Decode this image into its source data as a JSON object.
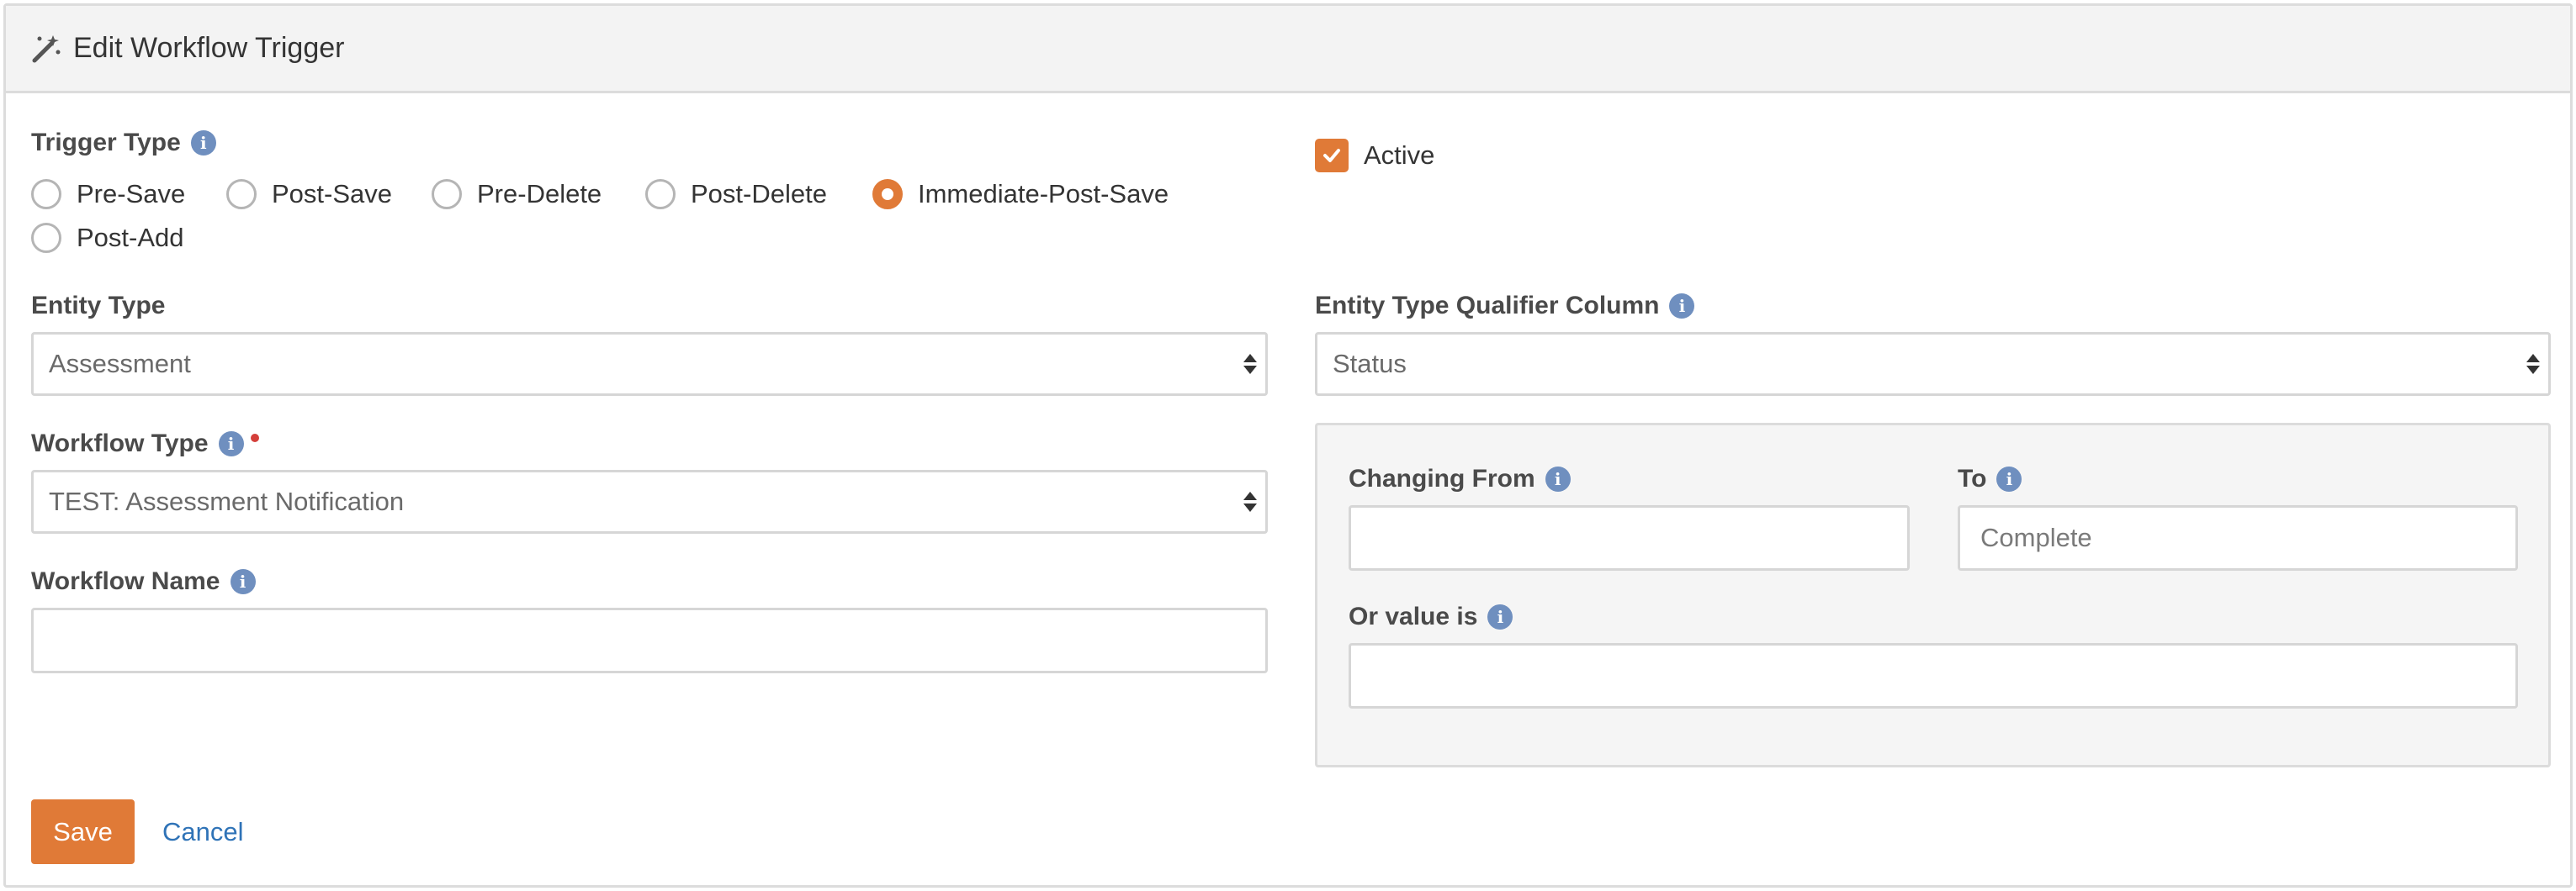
{
  "header": {
    "title": "Edit Workflow Trigger",
    "icon": "magic-wand-icon"
  },
  "trigger_type": {
    "label": "Trigger Type",
    "options": [
      "Pre-Save",
      "Post-Save",
      "Pre-Delete",
      "Post-Delete",
      "Immediate-Post-Save",
      "Post-Add"
    ],
    "selected": "Immediate-Post-Save"
  },
  "active": {
    "label": "Active",
    "checked": true
  },
  "entity_type": {
    "label": "Entity Type",
    "value": "Assessment"
  },
  "entity_qualifier": {
    "label": "Entity Type Qualifier Column",
    "value": "Status"
  },
  "workflow_type": {
    "label": "Workflow Type",
    "value": "TEST: Assessment Notification",
    "required": true
  },
  "workflow_name": {
    "label": "Workflow Name",
    "value": ""
  },
  "qualifier_values": {
    "changing_from_label": "Changing From",
    "changing_from_value": "",
    "to_label": "To",
    "to_placeholder": "Complete",
    "or_value_label": "Or value is",
    "or_value_value": ""
  },
  "actions": {
    "save_label": "Save",
    "cancel_label": "Cancel"
  },
  "colors": {
    "accent": "#e07a37",
    "link": "#2f73b7",
    "info": "#6f8fbf",
    "required": "#d43f3a"
  }
}
